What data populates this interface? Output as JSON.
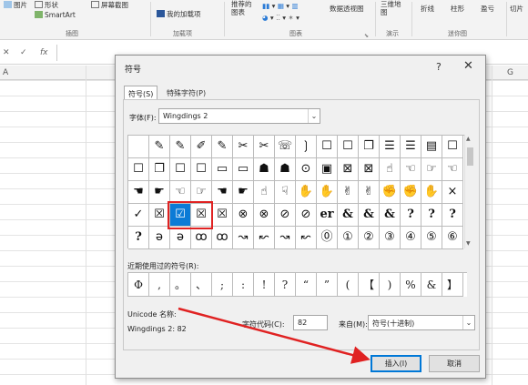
{
  "ribbon": {
    "items": {
      "pictures": "图片",
      "shapes": "形状",
      "smartart": "SmartArt",
      "screenshot": "屏幕截图",
      "addins": "我的加载项",
      "recommended_charts": "推荐的\n图表",
      "pivotchart": "数据透视图",
      "map3d": "三维地\n图",
      "sparkline_line": "折线",
      "sparkline_column": "柱形",
      "sparkline_winloss": "盈亏",
      "slicer": "切片"
    },
    "groups": {
      "illustrations": "插图",
      "addins_group": "加载项",
      "charts": "图表",
      "tours": "演示",
      "sparklines": "迷你图"
    }
  },
  "formula_bar": {
    "cancel": "✕",
    "enter": "✓",
    "fx": "fx"
  },
  "sheet": {
    "columns": {
      "a": "A",
      "g": "G"
    }
  },
  "dialog": {
    "title": "符号",
    "help": "?",
    "close": "✕",
    "tabs": {
      "symbols": "符号(S)",
      "special": "特殊字符(P)"
    },
    "font_label": "字体(F):",
    "font_value": "Wingdings 2",
    "recent_label": "近期使用过的符号(R):",
    "unicode_label": "Unicode 名称:",
    "unicode_value": "Wingdings 2: 82",
    "charcode_label": "字符代码(C):",
    "charcode_value": "82",
    "from_label": "来自(M):",
    "from_value": "符号(十进制)",
    "insert_button": "插入(I)",
    "cancel_button": "取消",
    "grid_rows": [
      [
        "",
        "✎",
        "✎",
        "✐",
        "✎",
        "✂",
        "✂",
        "☏",
        "❳",
        "☐",
        "☐",
        "❐",
        "☰",
        "☰",
        "▤",
        "☐"
      ],
      [
        "☐",
        "❐",
        "☐",
        "☐",
        "▭",
        "▭",
        "☗",
        "☗",
        "⊙",
        "▣",
        "⊠",
        "⊠",
        "☝",
        "☜",
        "☞",
        "☜"
      ],
      [
        "☚",
        "☛",
        "☜",
        "☞",
        "☚",
        "☛",
        "☝",
        "☟",
        "✋",
        "✋",
        "✌",
        "✌",
        "✊",
        "✊",
        "✋",
        "×"
      ],
      [
        "✓",
        "☒",
        "☑",
        "☒",
        "☒",
        "⊗",
        "⊗",
        "⊘",
        "⊘",
        "er",
        "&",
        "&",
        "&",
        "?",
        "?",
        "?"
      ],
      [
        "?",
        "ǝ",
        "ǝ",
        "ꝏ",
        "ꝏ",
        "↝",
        "↜",
        "↝",
        "↜",
        "⓪",
        "①",
        "②",
        "③",
        "④",
        "⑤",
        "⑥"
      ]
    ],
    "selected_symbol": "☑",
    "recent_symbols": [
      "Φ",
      ",",
      "。",
      "、",
      ";",
      ":",
      "!",
      "?",
      "“",
      "”",
      "(",
      "【",
      ")",
      "%",
      "&",
      "】"
    ]
  }
}
